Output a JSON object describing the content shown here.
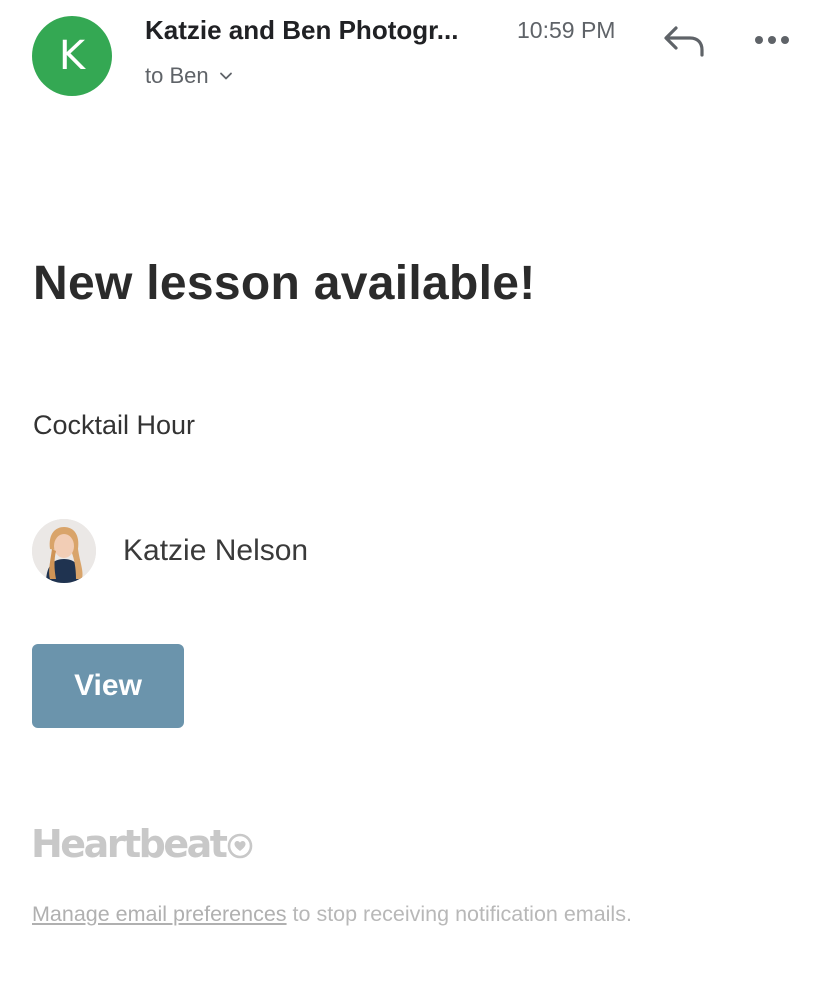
{
  "header": {
    "avatar_letter": "K",
    "sender_name": "Katzie and Ben Photogr...",
    "time": "10:59 PM",
    "recipient": "to Ben"
  },
  "email": {
    "headline": "New lesson available!",
    "lesson_title": "Cocktail Hour",
    "author_name": "Katzie Nelson",
    "view_button_label": "View"
  },
  "footer": {
    "brand": "Heartbeat",
    "manage_link": "Manage email preferences",
    "notice_rest": " to stop receiving notification emails."
  },
  "icons": {
    "reply": "reply-icon",
    "more": "more-options-icon",
    "chevron": "chevron-down-icon",
    "heart": "heart-icon"
  },
  "colors": {
    "avatar_bg": "#34a853",
    "button_bg": "#6b94ac",
    "brand_gray": "#c8c8c8"
  }
}
